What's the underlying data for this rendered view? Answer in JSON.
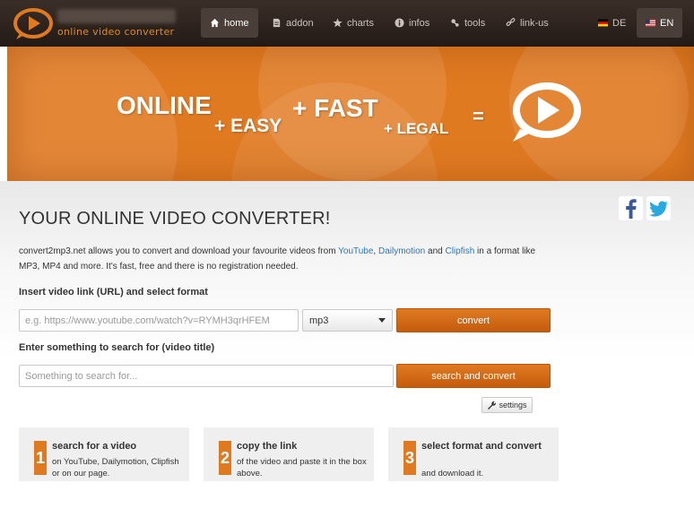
{
  "colors": {
    "accent": "#e07a21",
    "nav_bg": "#2f241f",
    "link": "#2a78c2"
  },
  "brand": {
    "tagline": "online video converter"
  },
  "nav": {
    "items": [
      {
        "label": "home",
        "icon": "home-icon"
      },
      {
        "label": "addon",
        "icon": "document-icon"
      },
      {
        "label": "charts",
        "icon": "star-icon"
      },
      {
        "label": "infos",
        "icon": "info-icon"
      },
      {
        "label": "tools",
        "icon": "tools-icon"
      },
      {
        "label": "link-us",
        "icon": "link-icon"
      }
    ],
    "languages": [
      {
        "label": "DE",
        "icon": "flag-de-icon"
      },
      {
        "label": "EN",
        "icon": "flag-us-icon"
      }
    ]
  },
  "hero": {
    "words": [
      "ONLINE",
      "+ EASY",
      "+ FAST",
      "+ LEGAL",
      "="
    ]
  },
  "main": {
    "title": "YOUR ONLINE VIDEO CONVERTER!",
    "desc_part1": "convert2mp3.net allows you to convert and download your favourite videos from ",
    "link_youtube": "YouTube",
    "desc_sep1": ", ",
    "link_dailymotion": "Dailymotion",
    "desc_sep2": " and ",
    "link_clipfish": "Clipfish",
    "desc_part2": " in a format like MP3, MP4 and more. It's fast, free and there is no registration needed.",
    "url_label": "Insert video link (URL) and select format",
    "url_placeholder": "e.g. https://www.youtube.com/watch?v=RYMH3qrHFEM",
    "format_value": "mp3",
    "convert_label": "convert",
    "search_label": "Enter something to search for (video title)",
    "search_placeholder": "Something to search for...",
    "search_button": "search and convert",
    "settings_label": "settings"
  },
  "steps": [
    {
      "num": "1",
      "title": "search for a video",
      "desc": "on YouTube, Dailymotion, Clipfish or on our page."
    },
    {
      "num": "2",
      "title": "copy the link",
      "desc": "of the video and paste it in the box above."
    },
    {
      "num": "3",
      "title": "select format and convert",
      "desc": "and download it."
    }
  ]
}
